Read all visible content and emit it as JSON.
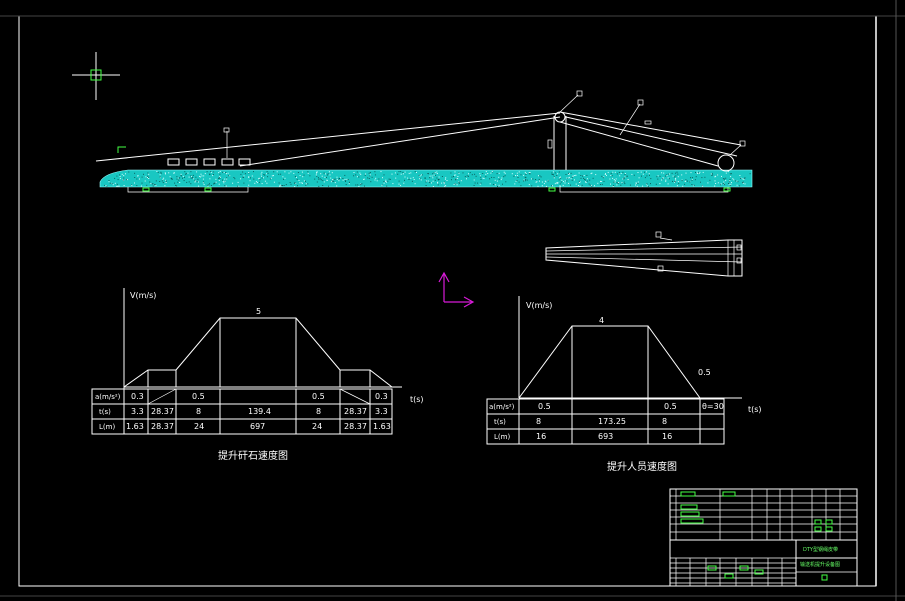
{
  "drawing": {
    "colors": {
      "background": "#000000",
      "lines": "#ffffff",
      "ground": "#19c7c2",
      "ucs": "#d81bd8",
      "annotation": "#33ff33"
    },
    "left_chart": {
      "axis_v": "V(m/s)",
      "axis_t": "t(s)",
      "peak_speed": "5",
      "row_labels": [
        "a(m/s²)",
        "t(s)",
        "L(m)"
      ],
      "rows": [
        [
          "0.3",
          "",
          "0.5",
          "",
          "0.5",
          "",
          "0.3"
        ],
        [
          "3.3",
          "28.37",
          "8",
          "139.4",
          "8",
          "28.37",
          "3.3"
        ],
        [
          "1.63",
          "28.37",
          "24",
          "697",
          "24",
          "28.37",
          "1.63"
        ]
      ],
      "caption": "提升矸石速度图"
    },
    "right_chart": {
      "axis_v": "V(m/s)",
      "axis_t": "t(s)",
      "peak_speed": "4",
      "end_speed": "0.5",
      "row_labels": [
        "a(m/s²)",
        "t(s)",
        "L(m)"
      ],
      "rows": [
        [
          "0.5",
          "",
          "0.5",
          "θ=30"
        ],
        [
          "8",
          "173.25",
          "8",
          ""
        ],
        [
          "16",
          "693",
          "16",
          ""
        ]
      ],
      "caption": "提升人员速度图"
    },
    "title_block": {
      "name_line1": "DTY型钢绳皮带",
      "name_line2": "输送机提升设备图",
      "drawing_no": "01"
    }
  }
}
